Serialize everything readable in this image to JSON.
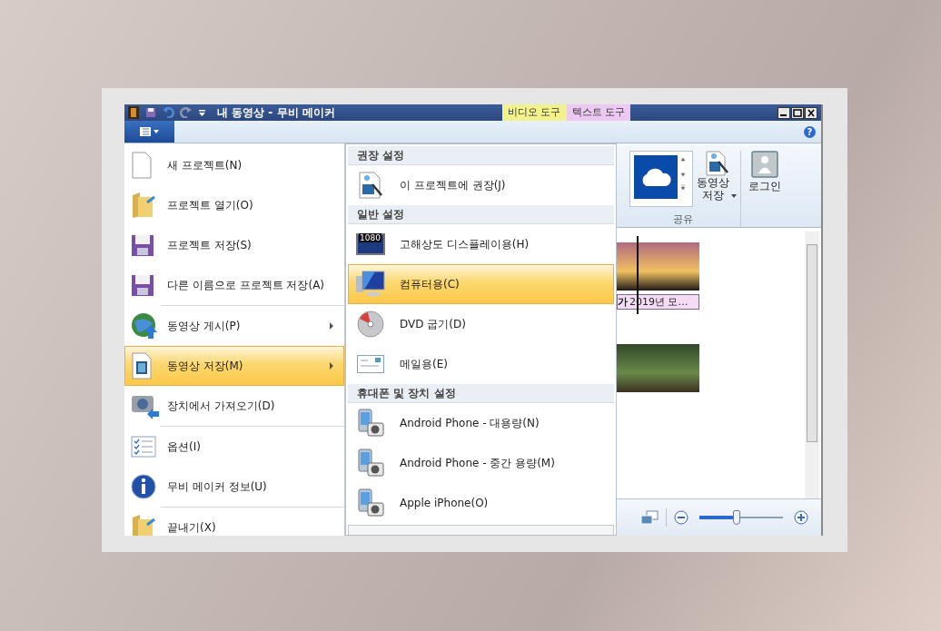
{
  "window": {
    "title": "내 동영상 - 무비 메이커",
    "context_tabs": [
      {
        "label": "비디오 도구",
        "color": "#f2f28c"
      },
      {
        "label": "텍스트 도구",
        "color": "#ecc8f2"
      }
    ]
  },
  "file_menu": {
    "groups": [
      {
        "items": [
          {
            "label": "새 프로젝트(N)",
            "submenu": false,
            "selected": false
          },
          {
            "label": "프로젝트 열기(O)",
            "submenu": false,
            "selected": false
          },
          {
            "label": "프로젝트 저장(S)",
            "submenu": false,
            "selected": false
          },
          {
            "label": "다른 이름으로 프로젝트 저장(A)",
            "submenu": false,
            "selected": false
          }
        ]
      },
      {
        "items": [
          {
            "label": "동영상 게시(P)",
            "submenu": true,
            "selected": false
          },
          {
            "label": "동영상 저장(M)",
            "submenu": true,
            "selected": true
          },
          {
            "label": "장치에서 가져오기(D)",
            "submenu": false,
            "selected": false
          }
        ]
      },
      {
        "items": [
          {
            "label": "옵션(I)",
            "submenu": false,
            "selected": false
          },
          {
            "label": "무비 메이커 정보(U)",
            "submenu": false,
            "selected": false
          }
        ]
      },
      {
        "items": [
          {
            "label": "끝내기(X)",
            "submenu": false,
            "selected": false
          }
        ]
      }
    ]
  },
  "save_submenu": {
    "sections": [
      {
        "heading": "권장 설정",
        "items": [
          {
            "label": "이 프로젝트에 권장(J)",
            "selected": false
          }
        ]
      },
      {
        "heading": "일반 설정",
        "items": [
          {
            "label": "고해상도 디스플레이용(H)",
            "badge": "1080",
            "selected": false
          },
          {
            "label": "컴퓨터용(C)",
            "selected": true
          },
          {
            "label": "DVD 굽기(D)",
            "selected": false
          },
          {
            "label": "메일용(E)",
            "selected": false
          }
        ]
      },
      {
        "heading": "휴대폰 및 장치 설정",
        "items": [
          {
            "label": "Android Phone - 대용량(N)",
            "selected": false
          },
          {
            "label": "Android Phone - 중간 용량(M)",
            "selected": false
          },
          {
            "label": "Apple iPhone(O)",
            "selected": false
          }
        ]
      }
    ]
  },
  "help_button": "?",
  "ribbon": {
    "save_button": "동영상\n저장",
    "login_button": "로그인",
    "group_label": "공유"
  },
  "storyboard": {
    "clips": [
      {
        "has_caption": true,
        "text_tag": "가",
        "caption": "2019년 모…"
      },
      {
        "has_caption": false
      }
    ]
  },
  "zoom": {
    "level": 0.41
  }
}
